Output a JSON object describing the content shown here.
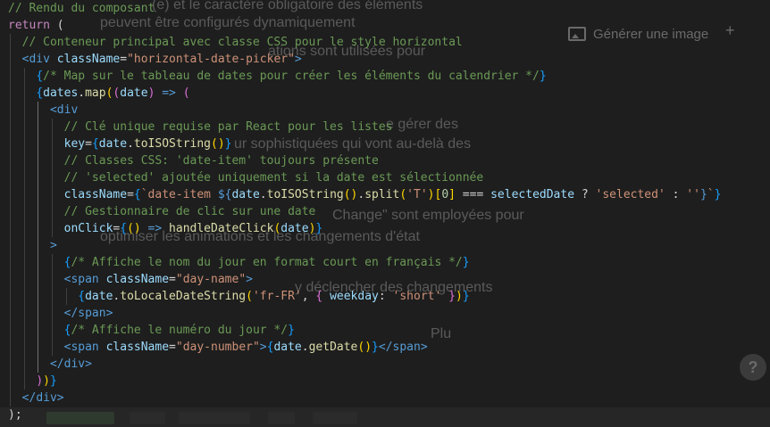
{
  "background_app": {
    "faint_lines": [
      "(e) et le caractère obligatoire des éléments",
      "peuvent être configurés dynamiquement",
      "ations sont utilisées pour",
      "e gérer des",
      "ur sophistiquées qui vont au-delà des",
      "Change\" sont employées pour",
      "optimiser les animations et les changements d'état",
      "y déclencher des changements",
      "Plu"
    ],
    "generate_image_label": "Générer une image",
    "generate_image_icon": "image-icon",
    "plus_label": "+",
    "help_label": "?"
  },
  "code": {
    "language": "jsx",
    "lines": [
      [
        {
          "t": "// Rendu du composant",
          "c": "com"
        }
      ],
      [
        {
          "t": "return",
          "c": "key"
        },
        {
          "t": " (",
          "c": "txt"
        }
      ],
      [
        {
          "t": "  // Conteneur principal avec classe CSS pour le style horizontal",
          "c": "com"
        }
      ],
      [
        {
          "t": "  <",
          "c": "jsx"
        },
        {
          "t": "div",
          "c": "jsx"
        },
        {
          "t": " ",
          "c": "txt"
        },
        {
          "t": "className",
          "c": "att"
        },
        {
          "t": "=",
          "c": "txt"
        },
        {
          "t": "\"horizontal-date-picker\"",
          "c": "str"
        },
        {
          "t": ">",
          "c": "jsx"
        }
      ],
      [
        {
          "t": "    ",
          "c": "txt"
        },
        {
          "t": "{",
          "c": "br3"
        },
        {
          "t": "/* Map sur le tableau de dates pour créer les éléments du calendrier */",
          "c": "com"
        },
        {
          "t": "}",
          "c": "br3"
        }
      ],
      [
        {
          "t": "    ",
          "c": "txt"
        },
        {
          "t": "{",
          "c": "br3"
        },
        {
          "t": "dates",
          "c": "var"
        },
        {
          "t": ".",
          "c": "txt"
        },
        {
          "t": "map",
          "c": "fn"
        },
        {
          "t": "(",
          "c": "br1"
        },
        {
          "t": "(",
          "c": "br2"
        },
        {
          "t": "date",
          "c": "var"
        },
        {
          "t": ")",
          "c": "br2"
        },
        {
          "t": " => ",
          "c": "jsx"
        },
        {
          "t": "(",
          "c": "br2"
        }
      ],
      [
        {
          "t": "      <",
          "c": "jsx"
        },
        {
          "t": "div",
          "c": "jsx"
        }
      ],
      [
        {
          "t": "        // Clé unique requise par React pour les listes",
          "c": "com"
        }
      ],
      [
        {
          "t": "        ",
          "c": "txt"
        },
        {
          "t": "key",
          "c": "att"
        },
        {
          "t": "=",
          "c": "txt"
        },
        {
          "t": "{",
          "c": "br3"
        },
        {
          "t": "date",
          "c": "var"
        },
        {
          "t": ".",
          "c": "txt"
        },
        {
          "t": "toISOString",
          "c": "fn"
        },
        {
          "t": "()",
          "c": "br1"
        },
        {
          "t": "}",
          "c": "br3"
        }
      ],
      [
        {
          "t": "        // Classes CSS: 'date-item' toujours présente",
          "c": "com"
        }
      ],
      [
        {
          "t": "        // 'selected' ajoutée uniquement si la date est sélectionnée",
          "c": "com"
        }
      ],
      [
        {
          "t": "        ",
          "c": "txt"
        },
        {
          "t": "className",
          "c": "att"
        },
        {
          "t": "=",
          "c": "txt"
        },
        {
          "t": "{",
          "c": "br3"
        },
        {
          "t": "`date-item ",
          "c": "str"
        },
        {
          "t": "${",
          "c": "jsx"
        },
        {
          "t": "date",
          "c": "var"
        },
        {
          "t": ".",
          "c": "txt"
        },
        {
          "t": "toISOString",
          "c": "fn"
        },
        {
          "t": "()",
          "c": "br1"
        },
        {
          "t": ".",
          "c": "txt"
        },
        {
          "t": "split",
          "c": "fn"
        },
        {
          "t": "(",
          "c": "br1"
        },
        {
          "t": "'T'",
          "c": "str"
        },
        {
          "t": ")",
          "c": "br1"
        },
        {
          "t": "[",
          "c": "br1"
        },
        {
          "t": "0",
          "c": "num"
        },
        {
          "t": "]",
          "c": "br1"
        },
        {
          "t": " === ",
          "c": "txt"
        },
        {
          "t": "selectedDate",
          "c": "var"
        },
        {
          "t": " ? ",
          "c": "txt"
        },
        {
          "t": "'selected'",
          "c": "str"
        },
        {
          "t": " : ",
          "c": "txt"
        },
        {
          "t": "''",
          "c": "str"
        },
        {
          "t": "}",
          "c": "jsx"
        },
        {
          "t": "`",
          "c": "str"
        },
        {
          "t": "}",
          "c": "br3"
        }
      ],
      [
        {
          "t": "        // Gestionnaire de clic sur une date",
          "c": "com"
        }
      ],
      [
        {
          "t": "        ",
          "c": "txt"
        },
        {
          "t": "onClick",
          "c": "att"
        },
        {
          "t": "=",
          "c": "txt"
        },
        {
          "t": "{",
          "c": "br3"
        },
        {
          "t": "()",
          "c": "br1"
        },
        {
          "t": " => ",
          "c": "jsx"
        },
        {
          "t": "handleDateClick",
          "c": "fn"
        },
        {
          "t": "(",
          "c": "br1"
        },
        {
          "t": "date",
          "c": "var"
        },
        {
          "t": ")",
          "c": "br1"
        },
        {
          "t": "}",
          "c": "br3"
        }
      ],
      [
        {
          "t": "      >",
          "c": "jsx"
        }
      ],
      [
        {
          "t": "        ",
          "c": "txt"
        },
        {
          "t": "{",
          "c": "br3"
        },
        {
          "t": "/* Affiche le nom du jour en format court en français */",
          "c": "com"
        },
        {
          "t": "}",
          "c": "br3"
        }
      ],
      [
        {
          "t": "        <",
          "c": "jsx"
        },
        {
          "t": "span",
          "c": "jsx"
        },
        {
          "t": " ",
          "c": "txt"
        },
        {
          "t": "className",
          "c": "att"
        },
        {
          "t": "=",
          "c": "txt"
        },
        {
          "t": "\"day-name\"",
          "c": "str"
        },
        {
          "t": ">",
          "c": "jsx"
        }
      ],
      [
        {
          "t": "          ",
          "c": "txt"
        },
        {
          "t": "{",
          "c": "br3"
        },
        {
          "t": "date",
          "c": "var"
        },
        {
          "t": ".",
          "c": "txt"
        },
        {
          "t": "toLocaleDateString",
          "c": "fn"
        },
        {
          "t": "(",
          "c": "br1"
        },
        {
          "t": "'fr-FR'",
          "c": "str"
        },
        {
          "t": ", ",
          "c": "txt"
        },
        {
          "t": "{",
          "c": "br2"
        },
        {
          "t": " weekday",
          "c": "att"
        },
        {
          "t": ": ",
          "c": "txt"
        },
        {
          "t": "'short'",
          "c": "str"
        },
        {
          "t": " }",
          "c": "br2"
        },
        {
          "t": ")",
          "c": "br1"
        },
        {
          "t": "}",
          "c": "br3"
        }
      ],
      [
        {
          "t": "        </",
          "c": "jsx"
        },
        {
          "t": "span",
          "c": "jsx"
        },
        {
          "t": ">",
          "c": "jsx"
        }
      ],
      [
        {
          "t": "        ",
          "c": "txt"
        },
        {
          "t": "{",
          "c": "br3"
        },
        {
          "t": "/* Affiche le numéro du jour */",
          "c": "com"
        },
        {
          "t": "}",
          "c": "br3"
        }
      ],
      [
        {
          "t": "        <",
          "c": "jsx"
        },
        {
          "t": "span",
          "c": "jsx"
        },
        {
          "t": " ",
          "c": "txt"
        },
        {
          "t": "className",
          "c": "att"
        },
        {
          "t": "=",
          "c": "txt"
        },
        {
          "t": "\"day-number\"",
          "c": "str"
        },
        {
          "t": ">",
          "c": "jsx"
        },
        {
          "t": "{",
          "c": "br3"
        },
        {
          "t": "date",
          "c": "var"
        },
        {
          "t": ".",
          "c": "txt"
        },
        {
          "t": "getDate",
          "c": "fn"
        },
        {
          "t": "()",
          "c": "br1"
        },
        {
          "t": "}",
          "c": "br3"
        },
        {
          "t": "</",
          "c": "jsx"
        },
        {
          "t": "span",
          "c": "jsx"
        },
        {
          "t": ">",
          "c": "jsx"
        }
      ],
      [
        {
          "t": "      </",
          "c": "jsx"
        },
        {
          "t": "div",
          "c": "jsx"
        },
        {
          "t": ">",
          "c": "jsx"
        }
      ],
      [
        {
          "t": "    ",
          "c": "txt"
        },
        {
          "t": ")",
          "c": "br2"
        },
        {
          "t": ")",
          "c": "br1"
        },
        {
          "t": "}",
          "c": "br3"
        }
      ],
      [
        {
          "t": "  </",
          "c": "jsx"
        },
        {
          "t": "div",
          "c": "jsx"
        },
        {
          "t": ">",
          "c": "jsx"
        }
      ],
      [
        {
          "t": ");",
          "c": "txt"
        }
      ]
    ]
  },
  "colors": {
    "background": "#1e1e1e",
    "comment": "#6a9955",
    "keyword": "#c586c0",
    "tag": "#569cd6",
    "attribute": "#9cdcfe",
    "string": "#ce9178",
    "function": "#dcdcaa",
    "bracket_gold": "#ffd700",
    "bracket_orchid": "#da70d6",
    "bracket_blue": "#179fff"
  }
}
